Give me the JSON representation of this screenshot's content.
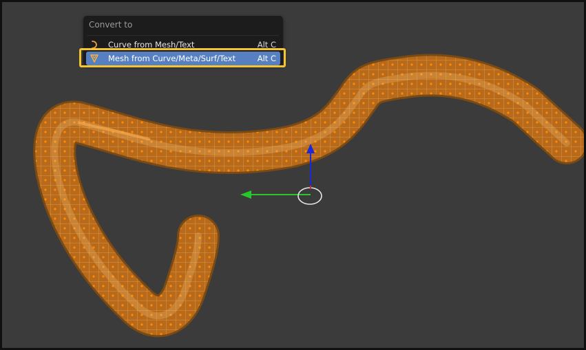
{
  "viewport": {
    "background": "#3b3b3b",
    "mesh_color": "#f09a2a"
  },
  "menu": {
    "title": "Convert to",
    "items": [
      {
        "icon": "curve-icon",
        "label": "Curve from Mesh/Text",
        "shortcut": "Alt C",
        "highlighted": false
      },
      {
        "icon": "mesh-icon",
        "label": "Mesh from Curve/Meta/Surf/Text",
        "shortcut": "Alt C",
        "highlighted": true
      }
    ]
  },
  "colors": {
    "menu_bg": "#1c1c1c",
    "menu_selected": "#5680c2",
    "highlight_frame": "#f5c431",
    "gizmo_x": "#28c828",
    "gizmo_z": "#1a2ad8"
  }
}
